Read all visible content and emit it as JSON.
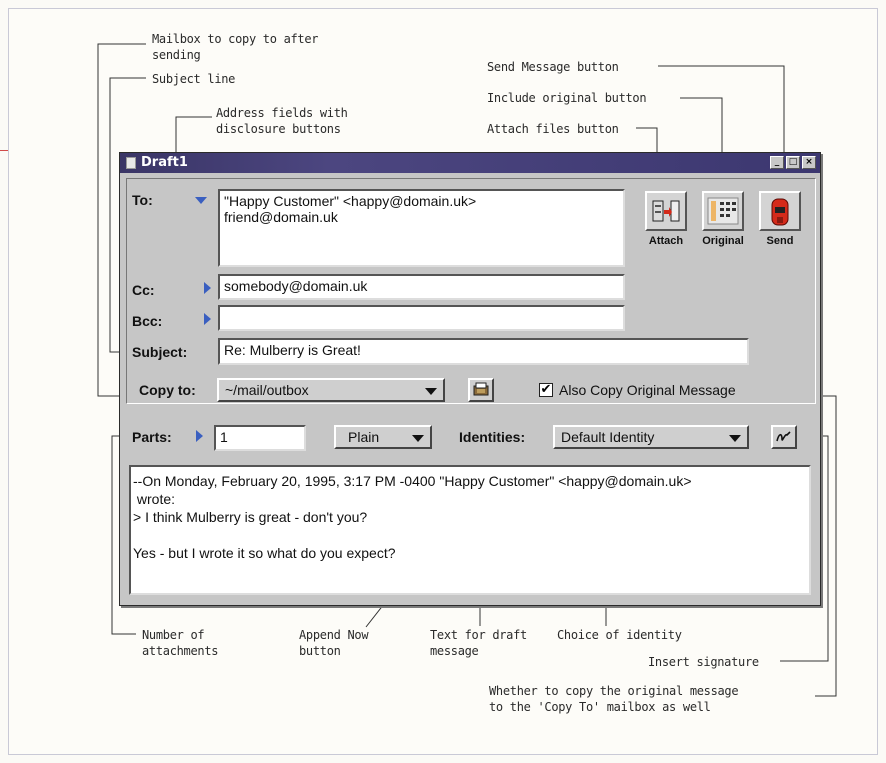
{
  "callouts": {
    "mailbox_copy": "Mailbox to copy to after\nsending",
    "subject_line": "Subject line",
    "address_fields": "Address fields with\ndisclosure buttons",
    "send_message": "Send Message button",
    "include_original": "Include original button",
    "attach_files": "Attach files button",
    "num_attachments": "Number of\nattachments",
    "append_now": "Append Now\nbutton",
    "text_draft": "Text for draft\nmessage",
    "choice_identity": "Choice of identity",
    "insert_signature": "Insert signature",
    "copy_original": "Whether to copy the original message\nto the 'Copy To' mailbox as well"
  },
  "window": {
    "title": "Draft1",
    "controls": [
      "_",
      "□",
      "×"
    ]
  },
  "header": {
    "to_label": "To:",
    "to_value": "\"Happy Customer\" <happy@domain.uk>\nfriend@domain.uk",
    "cc_label": "Cc:",
    "cc_value": "somebody@domain.uk",
    "bcc_label": "Bcc:",
    "bcc_value": "",
    "subject_label": "Subject:",
    "subject_value": "Re: Mulberry is Great!",
    "copyto_label": "Copy to:",
    "copyto_value": "~/mail/outbox",
    "also_copy_label": "Also Copy Original Message",
    "also_copy_checked": "✔"
  },
  "toolbar": {
    "attach_label": "Attach",
    "original_label": "Original",
    "send_label": "Send"
  },
  "parts_bar": {
    "parts_label": "Parts:",
    "parts_value": "1",
    "format_value": "Plain",
    "identities_label": "Identities:",
    "identity_value": "Default Identity"
  },
  "message": {
    "lines": [
      "--On Monday, February 20, 1995, 3:17 PM -0400 \"Happy Customer\" <happy@domain.uk>",
      " wrote:",
      "> I think Mulberry is great - don't you?",
      "",
      "Yes - but I wrote it so what do you expect?"
    ]
  },
  "colors": {
    "titlebar": "#3a3566",
    "disclosure": "#3a5fc0",
    "send_red": "#d42a1a"
  }
}
